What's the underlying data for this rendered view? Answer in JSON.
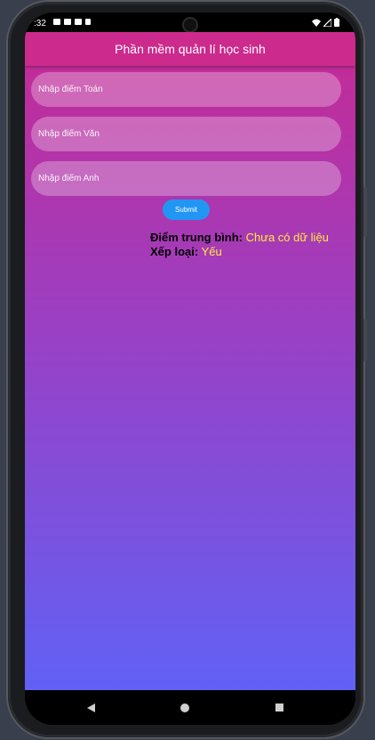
{
  "status_bar": {
    "time": ":32",
    "icons": [
      "notification-icon",
      "youtube-icon",
      "youtube-icon",
      "sim-icon",
      "wifi-icon",
      "signal-icon",
      "battery-icon"
    ]
  },
  "app": {
    "title": "Phần mềm quản lí học sinh",
    "fields": [
      {
        "placeholder": "Nhập điểm Toán",
        "value": ""
      },
      {
        "placeholder": "Nhập điểm Văn",
        "value": ""
      },
      {
        "placeholder": "Nhập điểm Anh",
        "value": ""
      }
    ],
    "submit_label": "Submit",
    "result": {
      "average_label": "Điểm trung bình:",
      "average_value": "Chưa có dữ liệu",
      "grade_label": "Xếp loại:",
      "grade_value": "Yếu"
    }
  },
  "colors": {
    "appbar": "#cc2a8c",
    "gradient_top": "#c62a93",
    "gradient_bottom": "#6161f5",
    "button": "#2196f3",
    "result_value": "#ffeb3b"
  },
  "nav_bar": {
    "icons": [
      "back-icon",
      "home-icon",
      "recents-icon"
    ]
  }
}
